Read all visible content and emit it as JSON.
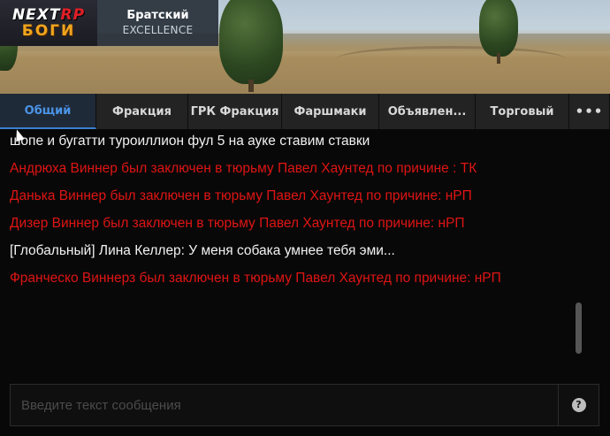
{
  "server": {
    "logo_top_a": "NEXT",
    "logo_top_b": "RP",
    "logo_bottom": "БОГИ",
    "name": "Братский",
    "subtitle": "EXCELLENCE"
  },
  "tabs": [
    {
      "label": "Общий",
      "active": true
    },
    {
      "label": "Фракция",
      "active": false
    },
    {
      "label": "ГРК Фракция",
      "active": false
    },
    {
      "label": "Фаршмаки",
      "active": false
    },
    {
      "label": "Объявлен...",
      "active": false
    },
    {
      "label": "Торговый",
      "active": false
    },
    {
      "label": "•••",
      "active": false,
      "icon": "more-icon"
    }
  ],
  "messages": [
    {
      "text": "шопе и бугатти туроиллион фул 5 на ауке ставим ставки",
      "color": "white"
    },
    {
      "text": "Андрюха Виннер был заключен в тюрьму Павел Хаунтед по причине : ТК",
      "color": "red"
    },
    {
      "text": "Данька Виннер был заключен в тюрьму Павел Хаунтед по причине: нРП",
      "color": "red"
    },
    {
      "text": "Дизер Виннер был заключен в тюрьму Павел Хаунтед по причине: нРП",
      "color": "red"
    },
    {
      "text": "[Глобальный] Лина Келлер: У меня собака умнее тебя эми...",
      "color": "white"
    },
    {
      "text": "Франческо Виннерз был заключен в тюрьму Павел Хаунтед по причине: нРП",
      "color": "red"
    }
  ],
  "input": {
    "placeholder": "Введите текст сообщения",
    "value": ""
  },
  "help_button": {
    "glyph": "?",
    "icon": "help-icon"
  },
  "colors": {
    "system_red": "#e01414",
    "chat_white": "#f2f2f2",
    "active_tab": "#4a94e8",
    "logo_accent": "#e21f26",
    "logo_gold": "#f0a51e"
  }
}
